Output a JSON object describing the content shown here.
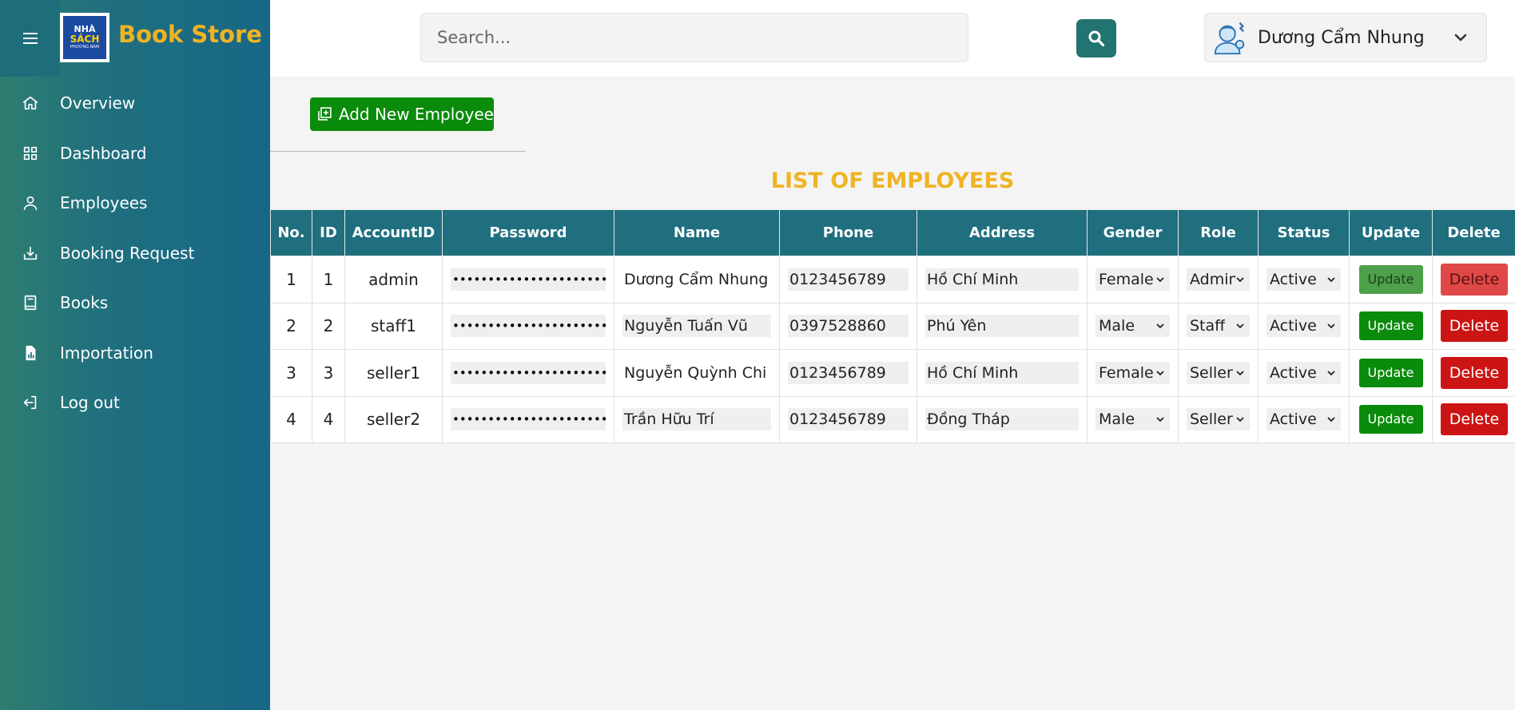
{
  "app": {
    "brand": "Book Store",
    "logo_text": [
      "NHÀ",
      "SÁCH",
      "PHƯƠNG NAM"
    ]
  },
  "sidebar": {
    "items": [
      {
        "label": "Overview",
        "icon": "home-icon"
      },
      {
        "label": "Dashboard",
        "icon": "grid-icon"
      },
      {
        "label": "Employees",
        "icon": "user-icon"
      },
      {
        "label": "Booking Request",
        "icon": "download-icon"
      },
      {
        "label": "Books",
        "icon": "book-icon"
      },
      {
        "label": "Importation",
        "icon": "file-chart-icon"
      },
      {
        "label": "Log out",
        "icon": "logout-icon"
      }
    ]
  },
  "header": {
    "search_placeholder": "Search...",
    "search_value": "",
    "user_name": "Dương Cẩm Nhung"
  },
  "main": {
    "add_button": "Add New Employee",
    "list_title": "LIST OF EMPLOYEES",
    "columns": [
      "No.",
      "ID",
      "AccountID",
      "Password",
      "Name",
      "Phone",
      "Address",
      "Gender",
      "Role",
      "Status",
      "Update",
      "Delete"
    ],
    "rows": [
      {
        "no": "1",
        "id": "1",
        "account": "admin",
        "password": "•••••••••••••••••••••••••",
        "name": "Dương Cẩm Nhung",
        "phone": "0123456789",
        "address": "Hồ Chí Minh",
        "gender": "Female",
        "role": "Admin",
        "status": "Active",
        "update": "Update",
        "delete": "Delete"
      },
      {
        "no": "2",
        "id": "2",
        "account": "staff1",
        "password": "•••••••••••••••••••••••••",
        "name": "Nguyễn Tuấn Vũ",
        "phone": "0397528860",
        "address": "Phú Yên",
        "gender": "Male",
        "role": "Staff",
        "status": "Active",
        "update": "Update",
        "delete": "Delete"
      },
      {
        "no": "3",
        "id": "3",
        "account": "seller1",
        "password": "•••••••••••••••••••••••••",
        "name": "Nguyễn Quỳnh Chi",
        "phone": "0123456789",
        "address": "Hồ Chí Minh",
        "gender": "Female",
        "role": "Seller",
        "status": "Active",
        "update": "Update",
        "delete": "Delete"
      },
      {
        "no": "4",
        "id": "4",
        "account": "seller2",
        "password": "•••••••••••••••••••••••••",
        "name": "Trần Hữu Trí",
        "phone": "0123456789",
        "address": "Đồng Tháp",
        "gender": "Male",
        "role": "Seller",
        "status": "Active",
        "update": "Update",
        "delete": "Delete"
      }
    ]
  },
  "colors": {
    "sidebar_start": "#2e7d70",
    "sidebar_end": "#176787",
    "header_row": "#1f6f7f",
    "brand": "#f0b323",
    "add_button": "#0b8b0b",
    "delete_button": "#cc1414"
  }
}
